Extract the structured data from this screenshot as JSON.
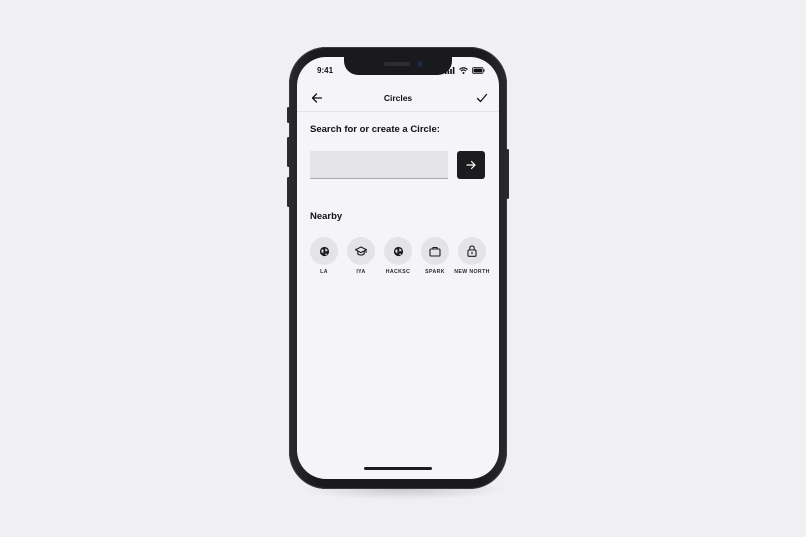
{
  "status_bar": {
    "time": "9:41"
  },
  "nav": {
    "title": "Circles",
    "back_icon": "arrow-left-icon",
    "done_icon": "checkmark-icon"
  },
  "search": {
    "heading": "Search for or create a Circle:",
    "value": "",
    "placeholder": ""
  },
  "nearby": {
    "heading": "Nearby",
    "circles": [
      {
        "label": "LA",
        "icon": "globe-icon"
      },
      {
        "label": "IYA",
        "icon": "graduation-cap-icon"
      },
      {
        "label": "HACKSC",
        "icon": "globe-icon"
      },
      {
        "label": "SPARK",
        "icon": "briefcase-icon"
      },
      {
        "label": "NEW NORTH",
        "icon": "lock-icon"
      }
    ]
  },
  "colors": {
    "background": "#f0eff4",
    "screen": "#f5f4f8",
    "accent": "#1c1c1e",
    "chip": "#e4e3e8"
  }
}
